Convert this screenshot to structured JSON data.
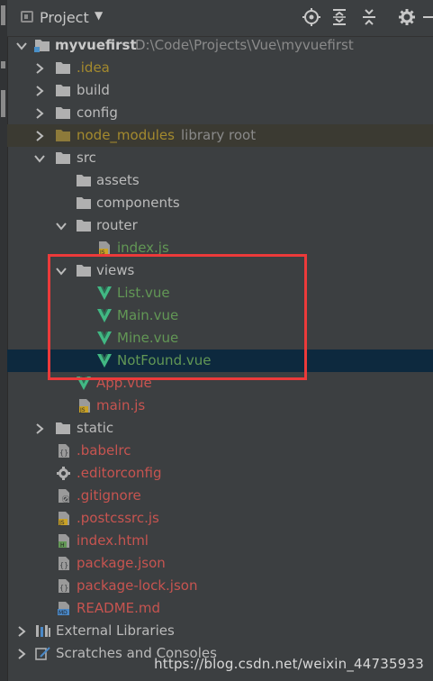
{
  "window": {
    "title": "Project"
  },
  "toolbar": {
    "buttons": [
      "locate-icon",
      "expand-all-icon",
      "collapse-all-icon",
      "settings-icon",
      "hide-icon"
    ]
  },
  "tree": {
    "root": {
      "name": "myvuefirst",
      "path": "D:\\Code\\Projects\\Vue\\myvuefirst"
    },
    "idea": ".idea",
    "build": "build",
    "config": "config",
    "node_modules": {
      "name": "node_modules",
      "hint": "library root"
    },
    "src": "src",
    "assets": "assets",
    "components": "components",
    "router": "router",
    "router_index": "index.js",
    "views": "views",
    "list_vue": "List.vue",
    "main_vue": "Main.vue",
    "mine_vue": "Mine.vue",
    "notfound_vue": "NotFound.vue",
    "app_vue": "App.vue",
    "main_js": "main.js",
    "static": "static",
    "babelrc": ".babelrc",
    "editorconfig": ".editorconfig",
    "gitignore": ".gitignore",
    "postcssrc": ".postcssrc.js",
    "index_html": "index.html",
    "package_json": "package.json",
    "package_lock": "package-lock.json",
    "readme": "README.md",
    "external_libs": "External Libraries",
    "scratches": "Scratches and Consoles"
  },
  "watermark": "https://blog.csdn.net/weixin_44735933",
  "colors": {
    "background": "#3c3f41",
    "selected_row": "#0d293e",
    "highlight_box": "#ec3a3a",
    "added_file": "#629755",
    "modified_file": "#c75450",
    "ignored_file": "#a48a2e"
  }
}
